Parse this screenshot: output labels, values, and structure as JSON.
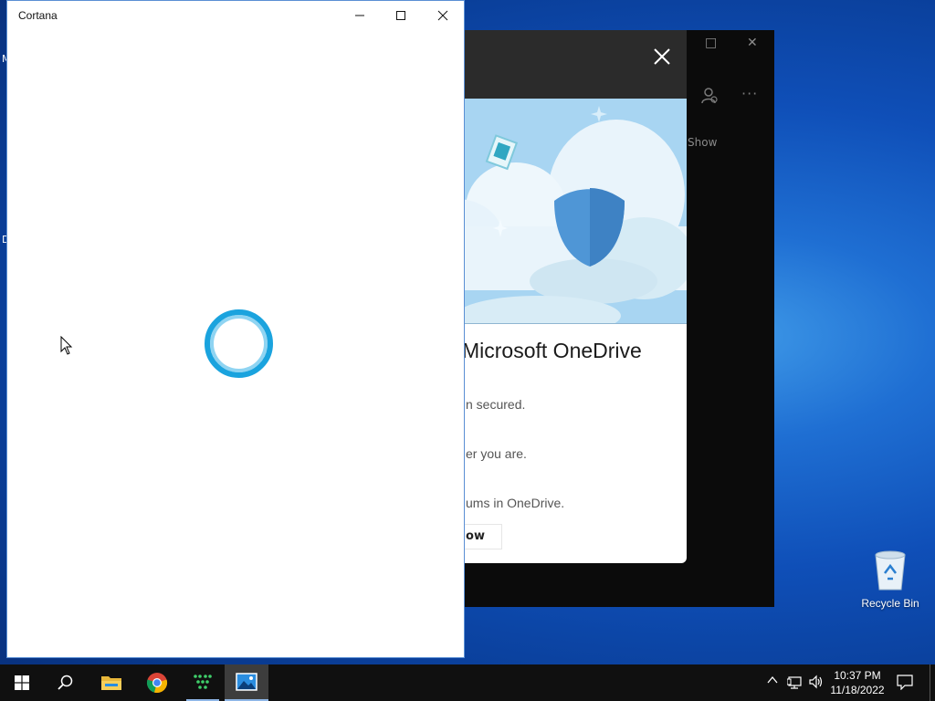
{
  "desktop": {
    "edge_letters": [
      "M",
      "D"
    ],
    "recycle_bin_label": "Recycle Bin"
  },
  "photos_window": {
    "show_label": "Show"
  },
  "onedrive_dialog": {
    "title": "Microsoft OneDrive",
    "lines": [
      "n secured.",
      "er you are.",
      "ums in OneDrive."
    ],
    "button_label": "low"
  },
  "cortana_window": {
    "title": "Cortana"
  },
  "taskbar": {
    "clock_time": "10:37 PM",
    "clock_date": "11/18/2022"
  },
  "colors": {
    "cortana_ring": "#1aa3de",
    "taskbar_bg": "#101010",
    "accent": "#8fb6e6"
  }
}
